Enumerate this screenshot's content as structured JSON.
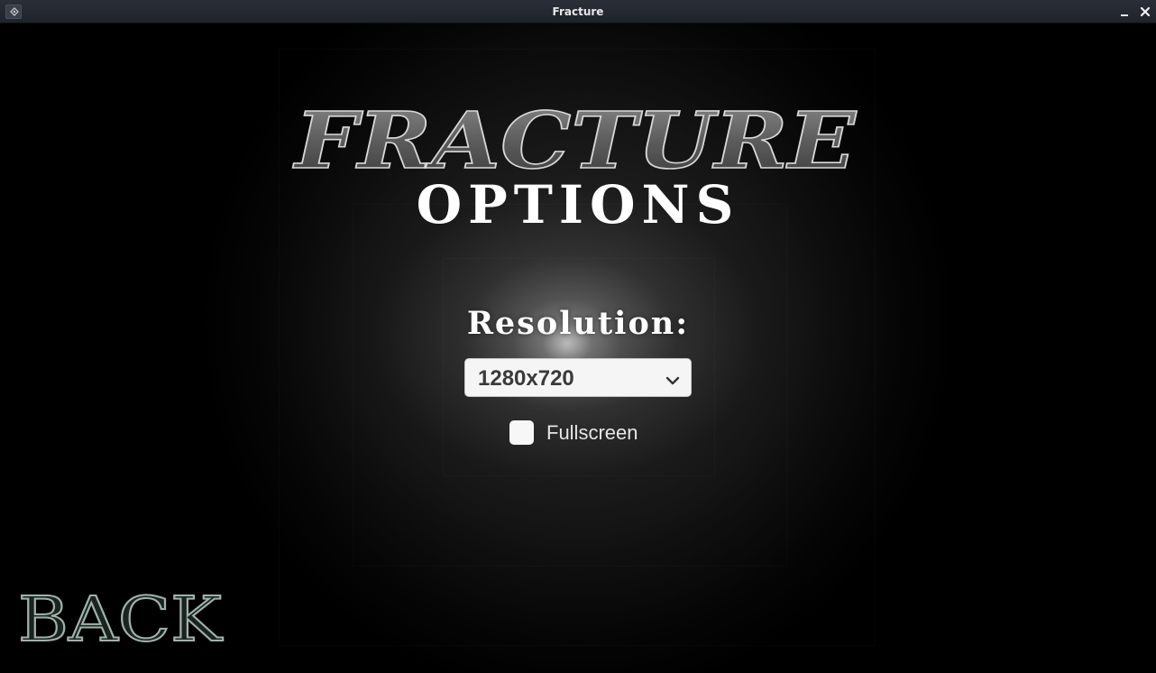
{
  "window": {
    "title": "Fracture",
    "app_icon": "godot-icon",
    "minimize_icon": "minimize-icon",
    "close_icon": "close-icon"
  },
  "logo": {
    "text": "FRACTURE"
  },
  "options": {
    "heading": "OPTIONS",
    "resolution_label": "Resolution:",
    "resolution_value": "1280x720",
    "fullscreen_label": "Fullscreen",
    "fullscreen_checked": false
  },
  "navigation": {
    "back_label": "BACK"
  },
  "colors": {
    "background": "#000000",
    "titlebar": "#23272e",
    "text": "#ffffff",
    "back_outline": "#8fa39a",
    "dropdown_bg": "#f5f5f5"
  }
}
